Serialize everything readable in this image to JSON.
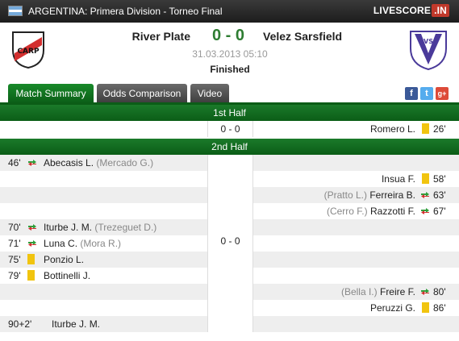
{
  "header": {
    "league": "ARGENTINA: Primera Division - Torneo Final",
    "site_logo": "LIVESCORE",
    "site_logo_suffix": ".IN"
  },
  "match": {
    "home_team": "River Plate",
    "away_team": "Velez Sarsfield",
    "score": "0 - 0",
    "datetime": "31.03.2013 05:10",
    "status": "Finished"
  },
  "tabs": [
    "Match Summary",
    "Odds Comparison",
    "Video"
  ],
  "share": {
    "facebook": "f",
    "twitter": "t",
    "googleplus": "g+"
  },
  "first_half": {
    "label": "1st Half",
    "score": "0 - 0",
    "event": {
      "player": "Romero L.",
      "time": "26'"
    }
  },
  "second_half": {
    "label": "2nd Half",
    "score": "0 - 0",
    "events": [
      {
        "time": "46'",
        "player": "Abecasis L.",
        "assist": "(Mercado G.)"
      },
      {
        "player": "Insua F.",
        "time": "58'"
      },
      {
        "assist": "(Pratto L.)",
        "player": "Ferreira B.",
        "time": "63'"
      },
      {
        "assist": "(Cerro F.)",
        "player": "Razzotti F.",
        "time": "67'"
      },
      {
        "time": "70'",
        "player": "Iturbe J. M.",
        "assist": "(Trezeguet D.)"
      },
      {
        "time": "71'",
        "player": "Luna C.",
        "assist": "(Mora R.)"
      },
      {
        "time": "75'",
        "player": "Ponzio L."
      },
      {
        "time": "79'",
        "player": "Bottinelli J."
      },
      {
        "assist": "(Bella I.)",
        "player": "Freire F.",
        "time": "80'"
      },
      {
        "player": "Peruzzi G.",
        "time": "86'"
      },
      {
        "time": "90+2'",
        "player": "Iturbe J. M."
      }
    ]
  }
}
